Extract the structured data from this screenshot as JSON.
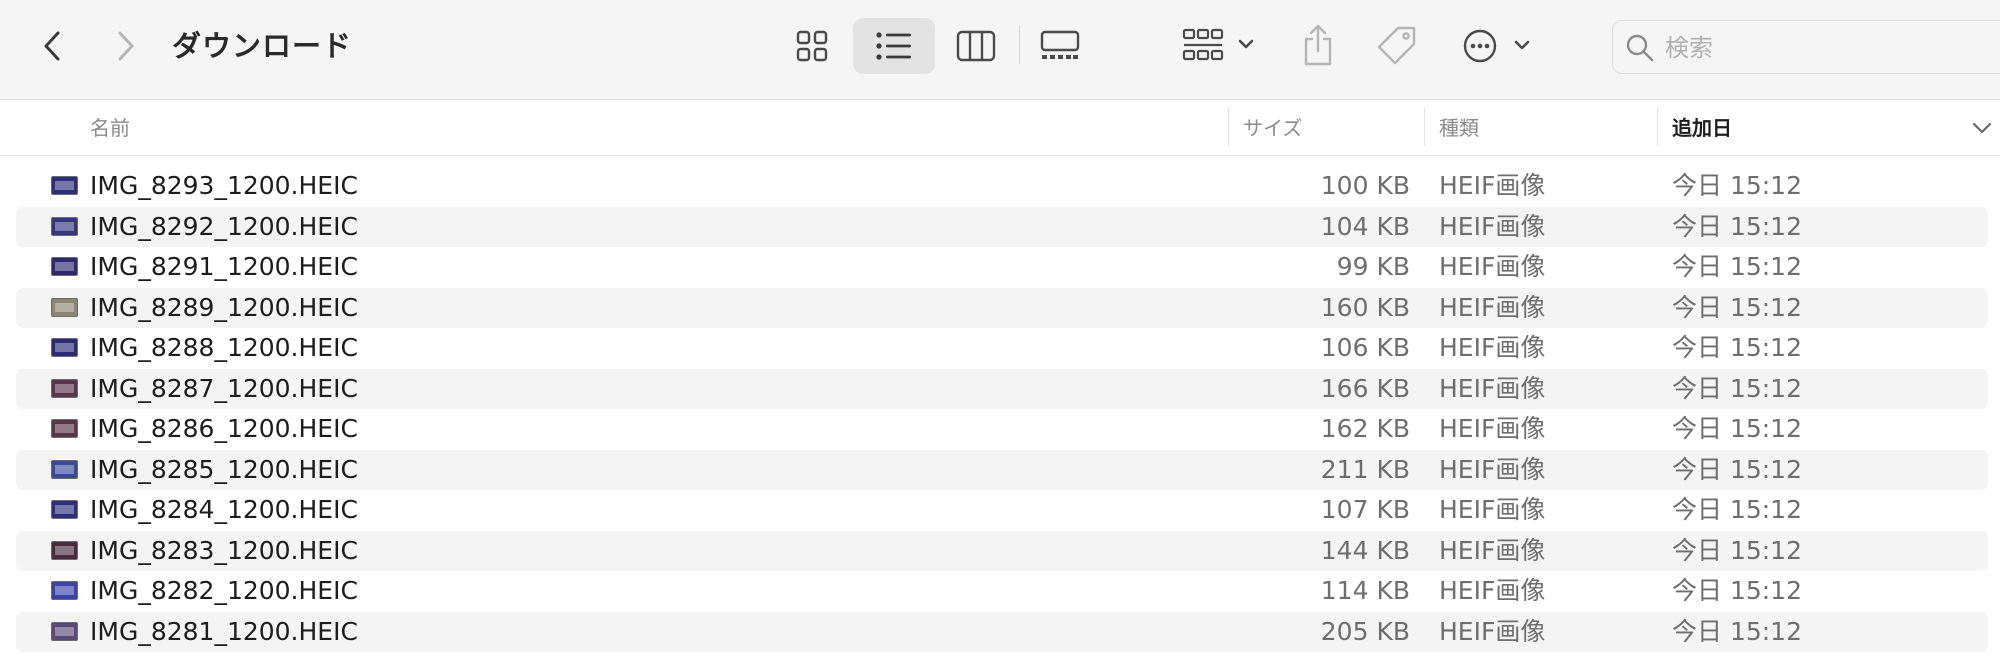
{
  "window": {
    "title": "ダウンロード"
  },
  "toolbar": {
    "view_modes": [
      "icon",
      "list",
      "column",
      "gallery"
    ],
    "selected_view": "list",
    "icons": {
      "back": "chevron-left-icon",
      "forward": "chevron-right-icon",
      "grid": "icon-view-icon",
      "list": "list-view-icon",
      "columns": "column-view-icon",
      "gallery": "gallery-view-icon",
      "group": "group-by-icon",
      "share": "share-icon",
      "tag": "tag-icon",
      "more": "ellipsis-circle-icon"
    }
  },
  "search": {
    "placeholder": "検索",
    "value": ""
  },
  "columns": {
    "name": "名前",
    "size": "サイズ",
    "kind": "種類",
    "date_added": "追加日",
    "sorted_by": "date_added"
  },
  "files": [
    {
      "name": "IMG_8293_1200.HEIC",
      "size": "100 KB",
      "kind": "HEIF画像",
      "date": "今日 15:12",
      "thumb_color": "#2b2f7a"
    },
    {
      "name": "IMG_8292_1200.HEIC",
      "size": "104 KB",
      "kind": "HEIF画像",
      "date": "今日 15:12",
      "thumb_color": "#33357f"
    },
    {
      "name": "IMG_8291_1200.HEIC",
      "size": "99 KB",
      "kind": "HEIF画像",
      "date": "今日 15:12",
      "thumb_color": "#2e2a6e"
    },
    {
      "name": "IMG_8289_1200.HEIC",
      "size": "160 KB",
      "kind": "HEIF画像",
      "date": "今日 15:12",
      "thumb_color": "#8a8670"
    },
    {
      "name": "IMG_8288_1200.HEIC",
      "size": "106 KB",
      "kind": "HEIF画像",
      "date": "今日 15:12",
      "thumb_color": "#2a2c74"
    },
    {
      "name": "IMG_8287_1200.HEIC",
      "size": "166 KB",
      "kind": "HEIF画像",
      "date": "今日 15:12",
      "thumb_color": "#5a3450"
    },
    {
      "name": "IMG_8286_1200.HEIC",
      "size": "162 KB",
      "kind": "HEIF画像",
      "date": "今日 15:12",
      "thumb_color": "#5b3548"
    },
    {
      "name": "IMG_8285_1200.HEIC",
      "size": "211 KB",
      "kind": "HEIF画像",
      "date": "今日 15:12",
      "thumb_color": "#3a4a9a"
    },
    {
      "name": "IMG_8284_1200.HEIC",
      "size": "107 KB",
      "kind": "HEIF画像",
      "date": "今日 15:12",
      "thumb_color": "#2d3080"
    },
    {
      "name": "IMG_8283_1200.HEIC",
      "size": "144 KB",
      "kind": "HEIF画像",
      "date": "今日 15:12",
      "thumb_color": "#4a2a3c"
    },
    {
      "name": "IMG_8282_1200.HEIC",
      "size": "114 KB",
      "kind": "HEIF画像",
      "date": "今日 15:12",
      "thumb_color": "#3b43a8"
    },
    {
      "name": "IMG_8281_1200.HEIC",
      "size": "205 KB",
      "kind": "HEIF画像",
      "date": "今日 15:12",
      "thumb_color": "#5a4a78"
    }
  ]
}
